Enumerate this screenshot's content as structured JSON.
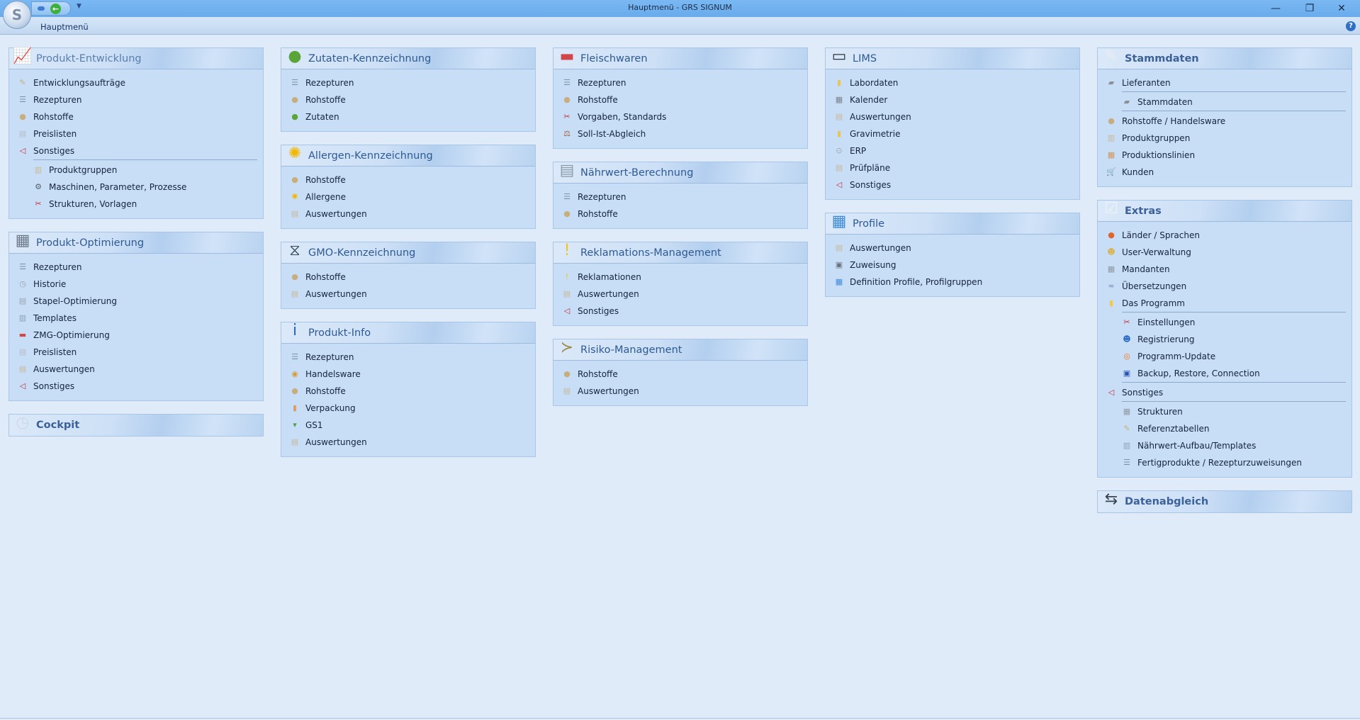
{
  "window": {
    "title": "Hauptmenü - GRS SIGNUM",
    "minimize": "—",
    "restore": "❐",
    "close": "✕"
  },
  "ribbon": {
    "tab": "Hauptmenü",
    "help": "?"
  },
  "columns": [
    {
      "panels": [
        {
          "title": "Produkt-Entwicklung",
          "icon": "chart-flask",
          "light": true,
          "items": [
            {
              "label": "Entwicklungsaufträge",
              "icon": "edit-form",
              "level": 0
            },
            {
              "label": "Rezepturen",
              "icon": "recipe",
              "level": 0
            },
            {
              "label": "Rohstoffe",
              "icon": "raw-material",
              "level": 0
            },
            {
              "label": "Preislisten",
              "icon": "price-list",
              "level": 0
            },
            {
              "label": "Sonstiges",
              "icon": "misc",
              "level": 0
            },
            {
              "label": "Produktgruppen",
              "icon": "product-group",
              "level": 1
            },
            {
              "label": "Maschinen, Parameter, Prozesse",
              "icon": "machine",
              "level": 1
            },
            {
              "label": "Strukturen, Vorlagen",
              "icon": "tools",
              "level": 1
            }
          ]
        },
        {
          "title": "Produkt-Optimierung",
          "icon": "calculator",
          "items": [
            {
              "label": "Rezepturen",
              "icon": "recipe",
              "level": 0
            },
            {
              "label": "Historie",
              "icon": "clock",
              "level": 0
            },
            {
              "label": "Stapel-Optimierung",
              "icon": "stack",
              "level": 0
            },
            {
              "label": "Templates",
              "icon": "template",
              "level": 0
            },
            {
              "label": "ZMG-Optimierung",
              "icon": "meat",
              "level": 0
            },
            {
              "label": "Preislisten",
              "icon": "price-list",
              "level": 0
            },
            {
              "label": "Auswertungen",
              "icon": "report",
              "level": 0
            },
            {
              "label": "Sonstiges",
              "icon": "misc",
              "level": 0
            }
          ]
        },
        {
          "title": "Cockpit",
          "icon": "cockpit",
          "bold": true,
          "items": []
        }
      ]
    },
    {
      "panels": [
        {
          "title": "Zutaten-Kennzeichnung",
          "icon": "ingredients",
          "items": [
            {
              "label": "Rezepturen",
              "icon": "recipe",
              "level": 0
            },
            {
              "label": "Rohstoffe",
              "icon": "raw-material",
              "level": 0
            },
            {
              "label": "Zutaten",
              "icon": "ingredients",
              "level": 0
            }
          ]
        },
        {
          "title": "Allergen-Kennzeichnung",
          "icon": "flower",
          "items": [
            {
              "label": "Rohstoffe",
              "icon": "raw-material",
              "level": 0
            },
            {
              "label": "Allergene",
              "icon": "flower",
              "level": 0
            },
            {
              "label": "Auswertungen",
              "icon": "report",
              "level": 0
            }
          ]
        },
        {
          "title": "GMO-Kennzeichnung",
          "icon": "dna",
          "items": [
            {
              "label": "Rohstoffe",
              "icon": "raw-material",
              "level": 0
            },
            {
              "label": "Auswertungen",
              "icon": "report",
              "level": 0
            }
          ]
        },
        {
          "title": "Produkt-Info",
          "icon": "info",
          "items": [
            {
              "label": "Rezepturen",
              "icon": "recipe",
              "level": 0
            },
            {
              "label": "Handelsware",
              "icon": "goods",
              "level": 0
            },
            {
              "label": "Rohstoffe",
              "icon": "raw-material",
              "level": 0
            },
            {
              "label": "Verpackung",
              "icon": "package",
              "level": 0
            },
            {
              "label": "GS1",
              "icon": "gs1",
              "level": 0
            },
            {
              "label": "Auswertungen",
              "icon": "report",
              "level": 0
            }
          ]
        }
      ]
    },
    {
      "panels": [
        {
          "title": "Fleischwaren",
          "icon": "meat",
          "items": [
            {
              "label": "Rezepturen",
              "icon": "recipe",
              "level": 0
            },
            {
              "label": "Rohstoffe",
              "icon": "raw-material",
              "level": 0
            },
            {
              "label": "Vorgaben, Standards",
              "icon": "tools",
              "level": 0
            },
            {
              "label": "Soll-Ist-Abgleich",
              "icon": "scale",
              "level": 0
            }
          ]
        },
        {
          "title": "Nährwert-Berechnung",
          "icon": "nutrition",
          "items": [
            {
              "label": "Rezepturen",
              "icon": "recipe",
              "level": 0
            },
            {
              "label": "Rohstoffe",
              "icon": "raw-material",
              "level": 0
            }
          ]
        },
        {
          "title": "Reklamations-Management",
          "icon": "warning",
          "items": [
            {
              "label": "Reklamationen",
              "icon": "warning",
              "level": 0
            },
            {
              "label": "Auswertungen",
              "icon": "report",
              "level": 0
            },
            {
              "label": "Sonstiges",
              "icon": "misc",
              "level": 0
            }
          ]
        },
        {
          "title": "Risiko-Management",
          "icon": "fish-warning",
          "items": [
            {
              "label": "Rohstoffe",
              "icon": "raw-material",
              "level": 0
            },
            {
              "label": "Auswertungen",
              "icon": "report",
              "level": 0
            }
          ]
        }
      ]
    },
    {
      "panels": [
        {
          "title": "LIMS",
          "icon": "monitor",
          "items": [
            {
              "label": "Labordaten",
              "icon": "lab-data",
              "level": 0
            },
            {
              "label": "Kalender",
              "icon": "calendar",
              "level": 0
            },
            {
              "label": "Auswertungen",
              "icon": "report",
              "level": 0
            },
            {
              "label": "Gravimetrie",
              "icon": "lab-data",
              "level": 0
            },
            {
              "label": "ERP",
              "icon": "erp",
              "level": 0
            },
            {
              "label": "Prüfpläne",
              "icon": "report",
              "level": 0
            },
            {
              "label": "Sonstiges",
              "icon": "misc",
              "level": 0
            }
          ]
        },
        {
          "title": "Profile",
          "icon": "profile",
          "items": [
            {
              "label": "Auswertungen",
              "icon": "report",
              "level": 0
            },
            {
              "label": "Zuweisung",
              "icon": "assign",
              "level": 0
            },
            {
              "label": "Definition Profile, Profilgruppen",
              "icon": "profile",
              "level": 0
            }
          ]
        }
      ]
    },
    {
      "panels": [
        {
          "title": "Stammdaten",
          "icon": "master-data",
          "bold": true,
          "items": [
            {
              "label": "Lieferanten",
              "icon": "truck",
              "level": 0
            },
            {
              "label": "Stammdaten",
              "icon": "truck",
              "level": 1
            },
            {
              "label": "Rohstoffe / Handelsware",
              "icon": "raw-material",
              "level": 0
            },
            {
              "label": "Produktgruppen",
              "icon": "product-group",
              "level": 0
            },
            {
              "label": "Produktionslinien",
              "icon": "production-line",
              "level": 0
            },
            {
              "label": "Kunden",
              "icon": "cart",
              "level": 0
            }
          ]
        },
        {
          "title": "Extras",
          "icon": "checklist",
          "bold": true,
          "items": [
            {
              "label": "Länder / Sprachen",
              "icon": "globe",
              "level": 0
            },
            {
              "label": "User-Verwaltung",
              "icon": "users",
              "level": 0
            },
            {
              "label": "Mandanten",
              "icon": "grid",
              "level": 0
            },
            {
              "label": "Übersetzungen",
              "icon": "translate",
              "level": 0
            },
            {
              "label": "Das Programm",
              "icon": "program",
              "level": 0
            },
            {
              "label": "Einstellungen",
              "icon": "tools",
              "level": 1
            },
            {
              "label": "Registrierung",
              "icon": "register",
              "level": 1
            },
            {
              "label": "Programm-Update",
              "icon": "update",
              "level": 1
            },
            {
              "label": "Backup, Restore, Connection",
              "icon": "backup",
              "level": 1
            },
            {
              "label": "Sonstiges",
              "icon": "misc",
              "level": 0
            },
            {
              "label": "Strukturen",
              "icon": "grid",
              "level": 1
            },
            {
              "label": "Referenztabellen",
              "icon": "edit-form",
              "level": 1
            },
            {
              "label": "Nährwert-Aufbau/Templates",
              "icon": "template",
              "level": 1
            },
            {
              "label": "Fertigprodukte / Rezepturzuweisungen",
              "icon": "recipe",
              "level": 1
            }
          ]
        },
        {
          "title": "Datenabgleich",
          "icon": "sync",
          "bold": true,
          "items": []
        }
      ]
    }
  ]
}
